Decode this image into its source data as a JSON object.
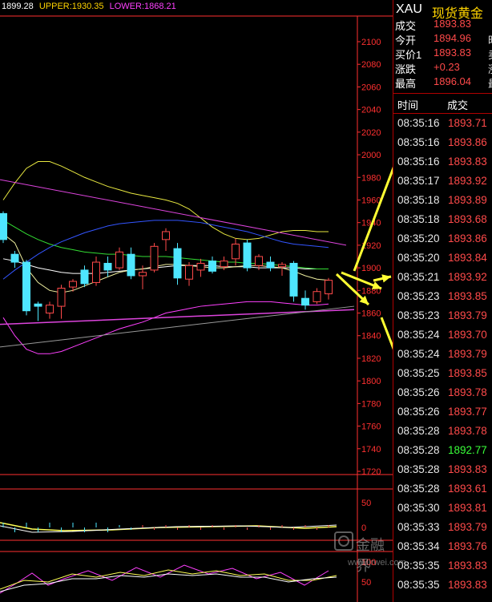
{
  "indicator_bar": {
    "mid": "1899.28",
    "upper": "UPPER:1930.35",
    "lower": "LOWER:1868.21"
  },
  "quote_panel": {
    "symbol": "XAU",
    "name": "现货黄金",
    "rows": [
      {
        "label": "成交",
        "value": "1893.83",
        "extra": ""
      },
      {
        "label": "今开",
        "value": "1894.96",
        "extra": "昨"
      },
      {
        "label": "买价1",
        "value": "1893.83",
        "extra": "卖"
      },
      {
        "label": "涨跌",
        "value": "+0.23",
        "extra": "涨"
      },
      {
        "label": "最高",
        "value": "1896.04",
        "extra": "最"
      }
    ]
  },
  "tick_list": {
    "headers": {
      "time": "时间",
      "price": "成交"
    },
    "rows": [
      {
        "time": "08:35:16",
        "price": "1893.71"
      },
      {
        "time": "08:35:16",
        "price": "1893.86"
      },
      {
        "time": "08:35:16",
        "price": "1893.83"
      },
      {
        "time": "08:35:17",
        "price": "1893.92"
      },
      {
        "time": "08:35:18",
        "price": "1893.89"
      },
      {
        "time": "08:35:18",
        "price": "1893.68"
      },
      {
        "time": "08:35:20",
        "price": "1893.86"
      },
      {
        "time": "08:35:20",
        "price": "1893.84"
      },
      {
        "time": "08:35:21",
        "price": "1893.92"
      },
      {
        "time": "08:35:23",
        "price": "1893.85"
      },
      {
        "time": "08:35:23",
        "price": "1893.79"
      },
      {
        "time": "08:35:24",
        "price": "1893.70"
      },
      {
        "time": "08:35:24",
        "price": "1893.79"
      },
      {
        "time": "08:35:25",
        "price": "1893.85"
      },
      {
        "time": "08:35:26",
        "price": "1893.78"
      },
      {
        "time": "08:35:26",
        "price": "1893.77"
      },
      {
        "time": "08:35:28",
        "price": "1893.78"
      },
      {
        "time": "08:35:28",
        "price": "1892.77",
        "down": true
      },
      {
        "time": "08:35:28",
        "price": "1893.83"
      },
      {
        "time": "08:35:28",
        "price": "1893.61"
      },
      {
        "time": "08:35:30",
        "price": "1893.81"
      },
      {
        "time": "08:35:33",
        "price": "1893.79"
      },
      {
        "time": "08:35:34",
        "price": "1893.76"
      },
      {
        "time": "08:35:35",
        "price": "1893.83"
      },
      {
        "time": "08:35:35",
        "price": "1893.83"
      }
    ]
  },
  "watermark": {
    "text": "金融界",
    "url": "www.jrwei.com"
  },
  "colors": {
    "up": "#ff4a4a",
    "down": "#39ff39",
    "axis": "#ff3030",
    "grid": "#8a0000",
    "candle_up": "#ff4a4a",
    "candle_down": "#4ee6ff",
    "arrow": "#ffff33"
  },
  "chart_data": {
    "type": "candlestick",
    "ylim": [
      1720,
      2100
    ],
    "y_ticks": [
      2100,
      2080,
      2060,
      2040,
      2020,
      2000,
      1980,
      1960,
      1940,
      1920,
      1900,
      1880,
      1860,
      1840,
      1820,
      1800,
      1780,
      1760,
      1740,
      1720
    ],
    "candles": [
      {
        "o": 1948,
        "h": 1950,
        "l": 1922,
        "c": 1925
      },
      {
        "o": 1912,
        "h": 1915,
        "l": 1900,
        "c": 1905
      },
      {
        "o": 1905,
        "h": 1907,
        "l": 1858,
        "c": 1862
      },
      {
        "o": 1868,
        "h": 1870,
        "l": 1853,
        "c": 1866
      },
      {
        "o": 1860,
        "h": 1870,
        "l": 1855,
        "c": 1867
      },
      {
        "o": 1866,
        "h": 1885,
        "l": 1855,
        "c": 1882
      },
      {
        "o": 1883,
        "h": 1890,
        "l": 1879,
        "c": 1888
      },
      {
        "o": 1898,
        "h": 1902,
        "l": 1883,
        "c": 1886
      },
      {
        "o": 1887,
        "h": 1910,
        "l": 1884,
        "c": 1905
      },
      {
        "o": 1904,
        "h": 1910,
        "l": 1892,
        "c": 1898
      },
      {
        "o": 1900,
        "h": 1918,
        "l": 1898,
        "c": 1914
      },
      {
        "o": 1912,
        "h": 1918,
        "l": 1890,
        "c": 1893
      },
      {
        "o": 1893,
        "h": 1902,
        "l": 1881,
        "c": 1896
      },
      {
        "o": 1898,
        "h": 1922,
        "l": 1896,
        "c": 1919
      },
      {
        "o": 1925,
        "h": 1935,
        "l": 1915,
        "c": 1932
      },
      {
        "o": 1917,
        "h": 1922,
        "l": 1885,
        "c": 1891
      },
      {
        "o": 1890,
        "h": 1905,
        "l": 1884,
        "c": 1902
      },
      {
        "o": 1898,
        "h": 1908,
        "l": 1892,
        "c": 1904
      },
      {
        "o": 1906,
        "h": 1910,
        "l": 1895,
        "c": 1897
      },
      {
        "o": 1901,
        "h": 1910,
        "l": 1898,
        "c": 1906
      },
      {
        "o": 1908,
        "h": 1926,
        "l": 1902,
        "c": 1921
      },
      {
        "o": 1922,
        "h": 1925,
        "l": 1897,
        "c": 1900
      },
      {
        "o": 1902,
        "h": 1912,
        "l": 1898,
        "c": 1910
      },
      {
        "o": 1905,
        "h": 1910,
        "l": 1897,
        "c": 1900
      },
      {
        "o": 1901,
        "h": 1905,
        "l": 1893,
        "c": 1903
      },
      {
        "o": 1904,
        "h": 1906,
        "l": 1870,
        "c": 1875
      },
      {
        "o": 1873,
        "h": 1880,
        "l": 1863,
        "c": 1867
      },
      {
        "o": 1870,
        "h": 1882,
        "l": 1868,
        "c": 1879
      },
      {
        "o": 1877,
        "h": 1891,
        "l": 1872,
        "c": 1889
      }
    ],
    "upper_band": [
      1960,
      1975,
      1988,
      1994,
      1994,
      1990,
      1985,
      1980,
      1976,
      1972,
      1969,
      1966,
      1964,
      1962,
      1960,
      1957,
      1952,
      1944,
      1936,
      1930,
      1926,
      1925,
      1926,
      1929,
      1932,
      1933,
      1933,
      1932,
      1932
    ],
    "middle_band": [
      1908,
      1906,
      1903,
      1900,
      1898,
      1896,
      1895,
      1895,
      1895,
      1896,
      1897,
      1898,
      1899,
      1900,
      1901,
      1902,
      1902,
      1902,
      1902,
      1901,
      1901,
      1901,
      1900,
      1900,
      1900,
      1900,
      1899,
      1899,
      1899
    ],
    "lower_band": [
      1856,
      1840,
      1828,
      1824,
      1824,
      1826,
      1830,
      1834,
      1838,
      1842,
      1846,
      1849,
      1852,
      1856,
      1860,
      1862,
      1864,
      1866,
      1867,
      1868,
      1869,
      1870,
      1870,
      1870,
      1869,
      1868,
      1867,
      1867,
      1868
    ],
    "ma_green": [
      1942,
      1936,
      1930,
      1925,
      1921,
      1918,
      1916,
      1914,
      1913,
      1912,
      1912,
      1911,
      1910,
      1910,
      1910,
      1909,
      1908,
      1907,
      1906,
      1905,
      1905,
      1904,
      1904,
      1903,
      1902,
      1901,
      1900,
      1899,
      1899
    ],
    "ma_blue": [
      1890,
      1898,
      1905,
      1912,
      1918,
      1923,
      1927,
      1931,
      1934,
      1937,
      1939,
      1940,
      1941,
      1942,
      1942,
      1942,
      1941,
      1940,
      1938,
      1936,
      1934,
      1932,
      1929,
      1926,
      1923,
      1921,
      1920,
      1919,
      1918
    ],
    "ma_white": [
      1930,
      1922,
      1900,
      1887,
      1880,
      1878,
      1880,
      1884,
      1888,
      1892,
      1896,
      1898,
      1899,
      1901,
      1903,
      1903,
      1902,
      1901,
      1900,
      1900,
      1901,
      1902,
      1902,
      1901,
      1900,
      1897,
      1893,
      1890,
      1889
    ],
    "trendline_upper": [
      1978,
      1920
    ],
    "trendline_lower": [
      1850,
      1863
    ],
    "trendline_grey": [
      1830,
      1866
    ],
    "sub1_ticks": [
      50,
      0
    ],
    "sub2_ticks": [
      100,
      50
    ]
  }
}
